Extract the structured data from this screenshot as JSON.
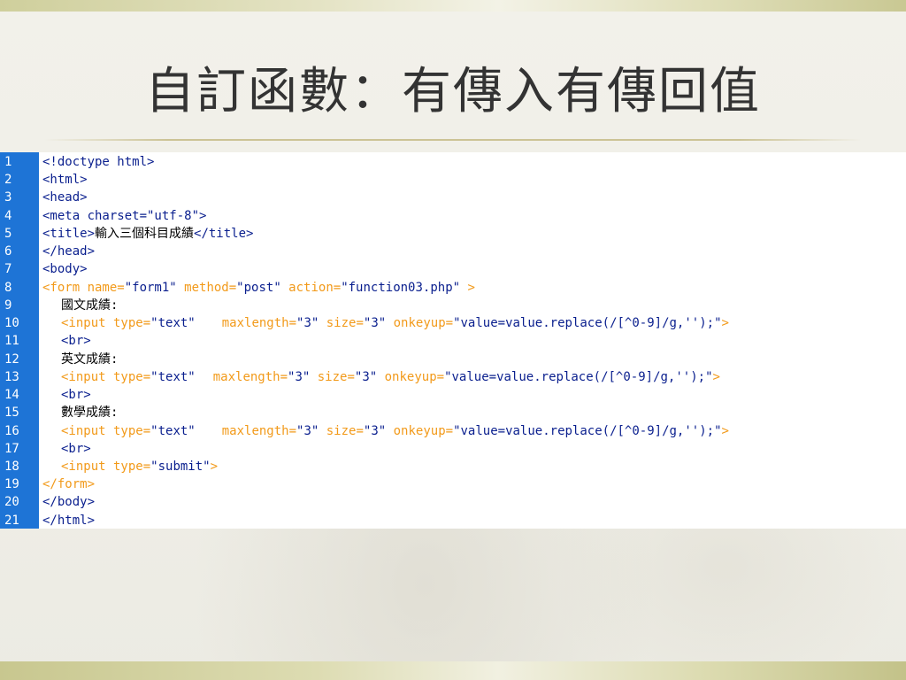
{
  "slide": {
    "title": "自訂函數：有傳入有傳回值",
    "colors": {
      "gutter": "#1e74d6",
      "tag": "#0a1f8e",
      "form_tag": "#f29a1a",
      "background": "#f3f2ec"
    }
  },
  "code": {
    "line_numbers": [
      "1",
      "2",
      "3",
      "4",
      "5",
      "6",
      "7",
      "8",
      "9",
      "10",
      "11",
      "12",
      "13",
      "14",
      "15",
      "16",
      "17",
      "18",
      "19",
      "20",
      "21"
    ],
    "l1": "<!doctype html>",
    "l2": "<html>",
    "l3": "<head>",
    "l4": "<meta charset=\"utf-8\">",
    "l5_open": "<title>",
    "l5_text": "輸入三個科目成績",
    "l5_close": "</title>",
    "l6": "</head>",
    "l7": "<body>",
    "l8_a": "<form name=",
    "l8_b": "\"form1\"",
    "l8_c": " method=",
    "l8_d": "\"post\"",
    "l8_e": " action=",
    "l8_f": "\"function03.php\"",
    "l8_g": " >",
    "l9": "國文成績:",
    "l10_a": "<input type=",
    "l10_b": "\"text\"",
    "l10_c": "maxlength=",
    "l10_d": "\"3\"",
    "l10_e": " size=",
    "l10_f": "\"3\"",
    "l10_g": " onkeyup=",
    "l10_h": "\"value=value.replace(/[^0-9]/g,'');\"",
    "l10_i": ">",
    "l11": "<br>",
    "l12": "英文成績:",
    "l13_a": "<input type=",
    "l13_b": "\"text\"",
    "l13_c": "maxlength=",
    "l13_d": "\"3\"",
    "l13_e": " size=",
    "l13_f": "\"3\"",
    "l13_g": " onkeyup=",
    "l13_h": "\"value=value.replace(/[^0-9]/g,'');\"",
    "l13_i": ">",
    "l14": "<br>",
    "l15": "數學成績:",
    "l16_a": "<input type=",
    "l16_b": "\"text\"",
    "l16_c": "maxlength=",
    "l16_d": "\"3\"",
    "l16_e": " size=",
    "l16_f": "\"3\"",
    "l16_g": " onkeyup=",
    "l16_h": "\"value=value.replace(/[^0-9]/g,'');\"",
    "l16_i": ">",
    "l17": "<br>",
    "l18_a": "<input type=",
    "l18_b": "\"submit\"",
    "l18_c": ">",
    "l19": "</form>",
    "l20": "</body>",
    "l21": "</html>"
  }
}
